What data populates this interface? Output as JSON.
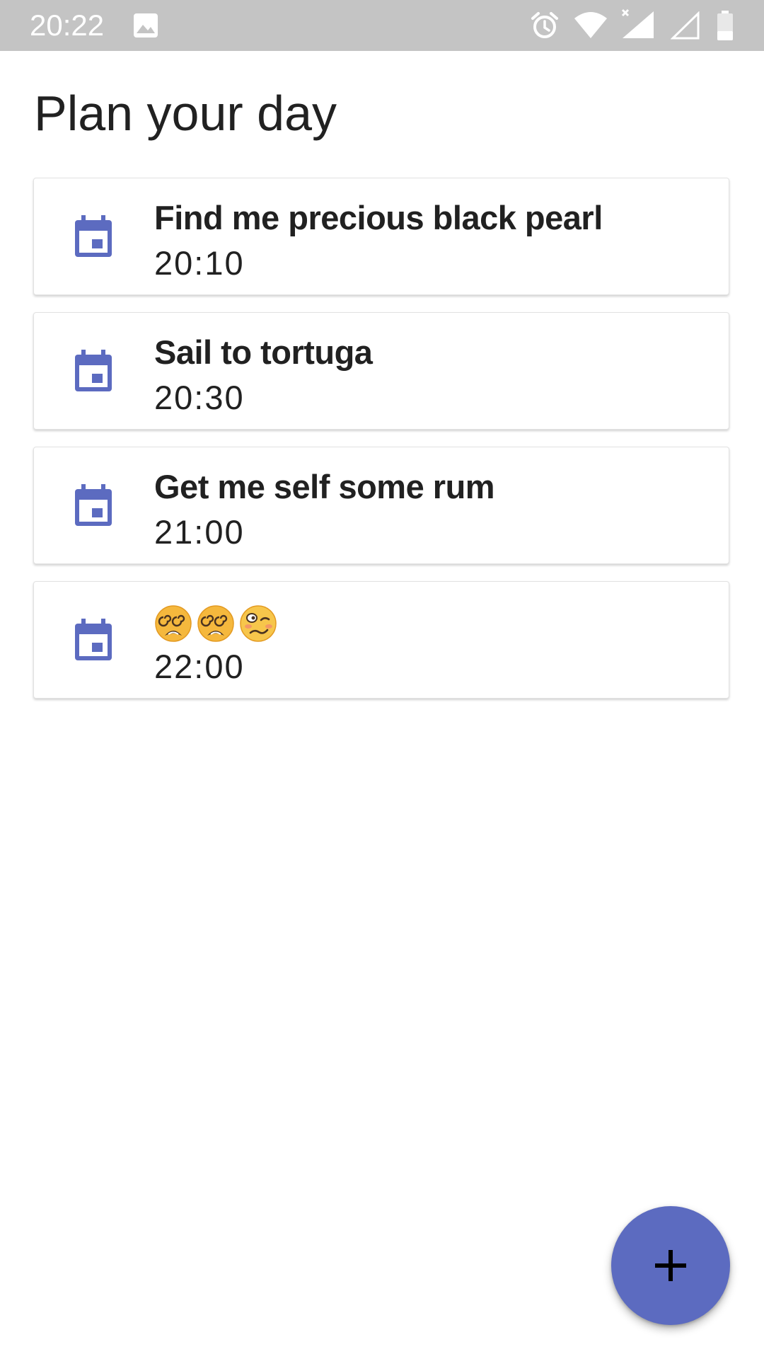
{
  "status_bar": {
    "time": "20:22",
    "icons": [
      "image-icon",
      "alarm-icon",
      "wifi-icon",
      "signal-icon",
      "signal-empty-icon",
      "battery-icon"
    ]
  },
  "page": {
    "title": "Plan your day"
  },
  "tasks": [
    {
      "title": "Find me precious black pearl",
      "time": "20:10",
      "icon": "calendar-icon"
    },
    {
      "title": "Sail to tortuga",
      "time": "20:30",
      "icon": "calendar-icon"
    },
    {
      "title": "Get me self some rum",
      "time": "21:00",
      "icon": "calendar-icon"
    },
    {
      "title": "😵😵🥴",
      "time": "22:00",
      "icon": "calendar-icon",
      "emoji_icons": [
        "dizzy-face-emoji",
        "dizzy-face-emoji",
        "woozy-face-emoji"
      ]
    }
  ],
  "fab": {
    "icon": "plus-icon"
  },
  "colors": {
    "status_bar_bg": "#c4c4c4",
    "accent": "#5c6bc0",
    "text_primary": "#212121",
    "card_border": "#e2e2e2"
  }
}
